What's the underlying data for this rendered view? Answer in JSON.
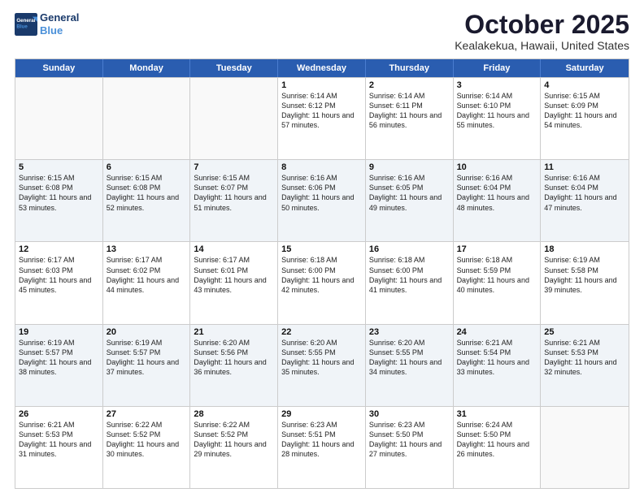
{
  "header": {
    "logo_line1": "General",
    "logo_line2": "Blue",
    "month": "October 2025",
    "location": "Kealakekua, Hawaii, United States"
  },
  "days_of_week": [
    "Sunday",
    "Monday",
    "Tuesday",
    "Wednesday",
    "Thursday",
    "Friday",
    "Saturday"
  ],
  "weeks": [
    [
      {
        "day": "",
        "sunrise": "",
        "sunset": "",
        "daylight": ""
      },
      {
        "day": "",
        "sunrise": "",
        "sunset": "",
        "daylight": ""
      },
      {
        "day": "",
        "sunrise": "",
        "sunset": "",
        "daylight": ""
      },
      {
        "day": "1",
        "sunrise": "Sunrise: 6:14 AM",
        "sunset": "Sunset: 6:12 PM",
        "daylight": "Daylight: 11 hours and 57 minutes."
      },
      {
        "day": "2",
        "sunrise": "Sunrise: 6:14 AM",
        "sunset": "Sunset: 6:11 PM",
        "daylight": "Daylight: 11 hours and 56 minutes."
      },
      {
        "day": "3",
        "sunrise": "Sunrise: 6:14 AM",
        "sunset": "Sunset: 6:10 PM",
        "daylight": "Daylight: 11 hours and 55 minutes."
      },
      {
        "day": "4",
        "sunrise": "Sunrise: 6:15 AM",
        "sunset": "Sunset: 6:09 PM",
        "daylight": "Daylight: 11 hours and 54 minutes."
      }
    ],
    [
      {
        "day": "5",
        "sunrise": "Sunrise: 6:15 AM",
        "sunset": "Sunset: 6:08 PM",
        "daylight": "Daylight: 11 hours and 53 minutes."
      },
      {
        "day": "6",
        "sunrise": "Sunrise: 6:15 AM",
        "sunset": "Sunset: 6:08 PM",
        "daylight": "Daylight: 11 hours and 52 minutes."
      },
      {
        "day": "7",
        "sunrise": "Sunrise: 6:15 AM",
        "sunset": "Sunset: 6:07 PM",
        "daylight": "Daylight: 11 hours and 51 minutes."
      },
      {
        "day": "8",
        "sunrise": "Sunrise: 6:16 AM",
        "sunset": "Sunset: 6:06 PM",
        "daylight": "Daylight: 11 hours and 50 minutes."
      },
      {
        "day": "9",
        "sunrise": "Sunrise: 6:16 AM",
        "sunset": "Sunset: 6:05 PM",
        "daylight": "Daylight: 11 hours and 49 minutes."
      },
      {
        "day": "10",
        "sunrise": "Sunrise: 6:16 AM",
        "sunset": "Sunset: 6:04 PM",
        "daylight": "Daylight: 11 hours and 48 minutes."
      },
      {
        "day": "11",
        "sunrise": "Sunrise: 6:16 AM",
        "sunset": "Sunset: 6:04 PM",
        "daylight": "Daylight: 11 hours and 47 minutes."
      }
    ],
    [
      {
        "day": "12",
        "sunrise": "Sunrise: 6:17 AM",
        "sunset": "Sunset: 6:03 PM",
        "daylight": "Daylight: 11 hours and 45 minutes."
      },
      {
        "day": "13",
        "sunrise": "Sunrise: 6:17 AM",
        "sunset": "Sunset: 6:02 PM",
        "daylight": "Daylight: 11 hours and 44 minutes."
      },
      {
        "day": "14",
        "sunrise": "Sunrise: 6:17 AM",
        "sunset": "Sunset: 6:01 PM",
        "daylight": "Daylight: 11 hours and 43 minutes."
      },
      {
        "day": "15",
        "sunrise": "Sunrise: 6:18 AM",
        "sunset": "Sunset: 6:00 PM",
        "daylight": "Daylight: 11 hours and 42 minutes."
      },
      {
        "day": "16",
        "sunrise": "Sunrise: 6:18 AM",
        "sunset": "Sunset: 6:00 PM",
        "daylight": "Daylight: 11 hours and 41 minutes."
      },
      {
        "day": "17",
        "sunrise": "Sunrise: 6:18 AM",
        "sunset": "Sunset: 5:59 PM",
        "daylight": "Daylight: 11 hours and 40 minutes."
      },
      {
        "day": "18",
        "sunrise": "Sunrise: 6:19 AM",
        "sunset": "Sunset: 5:58 PM",
        "daylight": "Daylight: 11 hours and 39 minutes."
      }
    ],
    [
      {
        "day": "19",
        "sunrise": "Sunrise: 6:19 AM",
        "sunset": "Sunset: 5:57 PM",
        "daylight": "Daylight: 11 hours and 38 minutes."
      },
      {
        "day": "20",
        "sunrise": "Sunrise: 6:19 AM",
        "sunset": "Sunset: 5:57 PM",
        "daylight": "Daylight: 11 hours and 37 minutes."
      },
      {
        "day": "21",
        "sunrise": "Sunrise: 6:20 AM",
        "sunset": "Sunset: 5:56 PM",
        "daylight": "Daylight: 11 hours and 36 minutes."
      },
      {
        "day": "22",
        "sunrise": "Sunrise: 6:20 AM",
        "sunset": "Sunset: 5:55 PM",
        "daylight": "Daylight: 11 hours and 35 minutes."
      },
      {
        "day": "23",
        "sunrise": "Sunrise: 6:20 AM",
        "sunset": "Sunset: 5:55 PM",
        "daylight": "Daylight: 11 hours and 34 minutes."
      },
      {
        "day": "24",
        "sunrise": "Sunrise: 6:21 AM",
        "sunset": "Sunset: 5:54 PM",
        "daylight": "Daylight: 11 hours and 33 minutes."
      },
      {
        "day": "25",
        "sunrise": "Sunrise: 6:21 AM",
        "sunset": "Sunset: 5:53 PM",
        "daylight": "Daylight: 11 hours and 32 minutes."
      }
    ],
    [
      {
        "day": "26",
        "sunrise": "Sunrise: 6:21 AM",
        "sunset": "Sunset: 5:53 PM",
        "daylight": "Daylight: 11 hours and 31 minutes."
      },
      {
        "day": "27",
        "sunrise": "Sunrise: 6:22 AM",
        "sunset": "Sunset: 5:52 PM",
        "daylight": "Daylight: 11 hours and 30 minutes."
      },
      {
        "day": "28",
        "sunrise": "Sunrise: 6:22 AM",
        "sunset": "Sunset: 5:52 PM",
        "daylight": "Daylight: 11 hours and 29 minutes."
      },
      {
        "day": "29",
        "sunrise": "Sunrise: 6:23 AM",
        "sunset": "Sunset: 5:51 PM",
        "daylight": "Daylight: 11 hours and 28 minutes."
      },
      {
        "day": "30",
        "sunrise": "Sunrise: 6:23 AM",
        "sunset": "Sunset: 5:50 PM",
        "daylight": "Daylight: 11 hours and 27 minutes."
      },
      {
        "day": "31",
        "sunrise": "Sunrise: 6:24 AM",
        "sunset": "Sunset: 5:50 PM",
        "daylight": "Daylight: 11 hours and 26 minutes."
      },
      {
        "day": "",
        "sunrise": "",
        "sunset": "",
        "daylight": ""
      }
    ]
  ]
}
